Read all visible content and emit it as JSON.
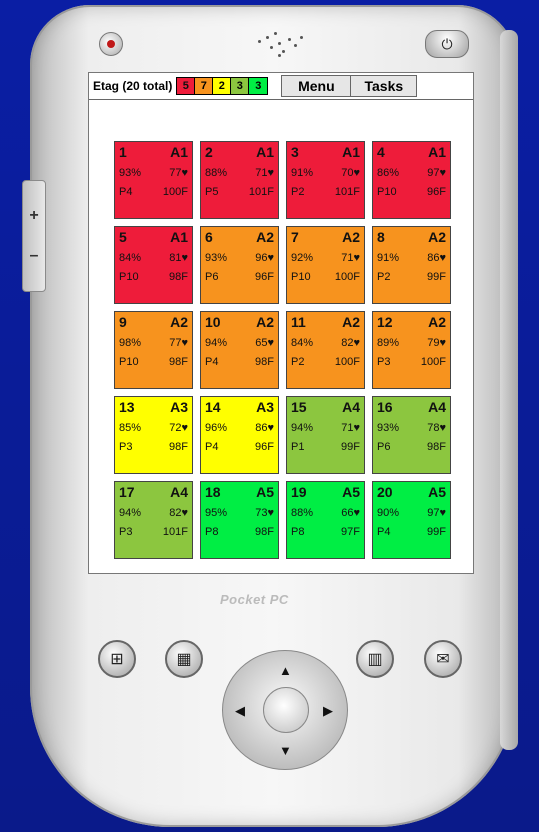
{
  "app": {
    "title": "Etag (20 total)",
    "counts": [
      {
        "value": "5",
        "color": "#ee1c3a"
      },
      {
        "value": "7",
        "color": "#f7931e"
      },
      {
        "value": "2",
        "color": "#ffff00"
      },
      {
        "value": "3",
        "color": "#8cc63f"
      },
      {
        "value": "3",
        "color": "#00ee44"
      }
    ],
    "menu_label": "Menu",
    "tasks_label": "Tasks"
  },
  "hardware": {
    "power_glyph": "⏻",
    "logo_text": "Pocket PC",
    "buttons": [
      "start-flag-icon",
      "calendar-icon",
      "contacts-icon",
      "inbox-icon"
    ],
    "icons": {
      "calendar": "▦",
      "contacts": "▥",
      "inbox": "✉",
      "start": "⊞"
    },
    "dpad_arrows": {
      "up": "▲",
      "down": "▼",
      "left": "◀",
      "right": "▶"
    }
  },
  "tiles": [
    {
      "id": "1",
      "area": "A1",
      "pct": "93%",
      "hr": "77♥",
      "pos": "P4",
      "temp": "100F",
      "color": "#ee1c3a"
    },
    {
      "id": "2",
      "area": "A1",
      "pct": "88%",
      "hr": "71♥",
      "pos": "P5",
      "temp": "101F",
      "color": "#ee1c3a"
    },
    {
      "id": "3",
      "area": "A1",
      "pct": "91%",
      "hr": "70♥",
      "pos": "P2",
      "temp": "101F",
      "color": "#ee1c3a"
    },
    {
      "id": "4",
      "area": "A1",
      "pct": "86%",
      "hr": "97♥",
      "pos": "P10",
      "temp": "96F",
      "color": "#ee1c3a"
    },
    {
      "id": "5",
      "area": "A1",
      "pct": "84%",
      "hr": "81♥",
      "pos": "P10",
      "temp": "98F",
      "color": "#ee1c3a"
    },
    {
      "id": "6",
      "area": "A2",
      "pct": "93%",
      "hr": "96♥",
      "pos": "P6",
      "temp": "96F",
      "color": "#f7931e"
    },
    {
      "id": "7",
      "area": "A2",
      "pct": "92%",
      "hr": "71♥",
      "pos": "P10",
      "temp": "100F",
      "color": "#f7931e"
    },
    {
      "id": "8",
      "area": "A2",
      "pct": "91%",
      "hr": "86♥",
      "pos": "P2",
      "temp": "99F",
      "color": "#f7931e"
    },
    {
      "id": "9",
      "area": "A2",
      "pct": "98%",
      "hr": "77♥",
      "pos": "P10",
      "temp": "98F",
      "color": "#f7931e"
    },
    {
      "id": "10",
      "area": "A2",
      "pct": "94%",
      "hr": "65♥",
      "pos": "P4",
      "temp": "98F",
      "color": "#f7931e"
    },
    {
      "id": "11",
      "area": "A2",
      "pct": "84%",
      "hr": "82♥",
      "pos": "P2",
      "temp": "100F",
      "color": "#f7931e"
    },
    {
      "id": "12",
      "area": "A2",
      "pct": "89%",
      "hr": "79♥",
      "pos": "P3",
      "temp": "100F",
      "color": "#f7931e"
    },
    {
      "id": "13",
      "area": "A3",
      "pct": "85%",
      "hr": "72♥",
      "pos": "P3",
      "temp": "98F",
      "color": "#ffff00"
    },
    {
      "id": "14",
      "area": "A3",
      "pct": "96%",
      "hr": "86♥",
      "pos": "P4",
      "temp": "96F",
      "color": "#ffff00"
    },
    {
      "id": "15",
      "area": "A4",
      "pct": "94%",
      "hr": "71♥",
      "pos": "P1",
      "temp": "99F",
      "color": "#8cc63f"
    },
    {
      "id": "16",
      "area": "A4",
      "pct": "93%",
      "hr": "78♥",
      "pos": "P6",
      "temp": "98F",
      "color": "#8cc63f"
    },
    {
      "id": "17",
      "area": "A4",
      "pct": "94%",
      "hr": "82♥",
      "pos": "P3",
      "temp": "101F",
      "color": "#8cc63f"
    },
    {
      "id": "18",
      "area": "A5",
      "pct": "95%",
      "hr": "73♥",
      "pos": "P8",
      "temp": "98F",
      "color": "#00ee44"
    },
    {
      "id": "19",
      "area": "A5",
      "pct": "88%",
      "hr": "66♥",
      "pos": "P8",
      "temp": "97F",
      "color": "#00ee44"
    },
    {
      "id": "20",
      "area": "A5",
      "pct": "90%",
      "hr": "97♥",
      "pos": "P4",
      "temp": "99F",
      "color": "#00ee44"
    }
  ]
}
